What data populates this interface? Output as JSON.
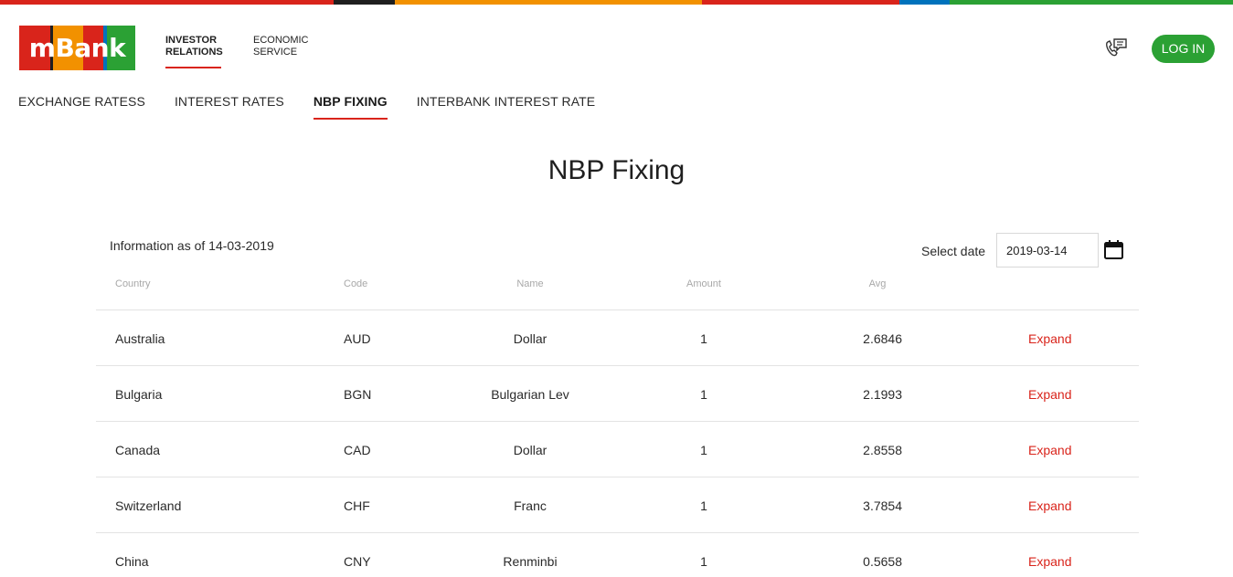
{
  "brand": {
    "logo_text": "mBank",
    "stripe_colors": [
      "#d9241b",
      "#1f1f1f",
      "#f29100",
      "#d9241b",
      "#0072bc",
      "#2ba134"
    ],
    "accent": "#d9241b",
    "login_color": "#2ba134"
  },
  "topnav": {
    "investor_relations": "INVESTOR RELATIONS",
    "economic_service": "ECONOMIC SERVICE"
  },
  "header": {
    "contact_icon": "phone-chat-icon",
    "login_label": "LOG IN"
  },
  "subnav": {
    "tabs": [
      {
        "label": "EXCHANGE RATESS"
      },
      {
        "label": "INTEREST RATES"
      },
      {
        "label": "NBP FIXING",
        "active": true
      },
      {
        "label": "INTERBANK INTEREST RATE"
      }
    ]
  },
  "page": {
    "title": "NBP Fixing",
    "info": "Information as of 14-03-2019",
    "select_date_label": "Select date",
    "date_value": "2019-03-14",
    "calendar_icon": "calendar-icon"
  },
  "table": {
    "headers": {
      "country": "Country",
      "code": "Code",
      "name": "Name",
      "amount": "Amount",
      "avg": "Avg"
    },
    "rows": [
      {
        "country": "Australia",
        "code": "AUD",
        "name": "Dollar",
        "amount": "1",
        "avg": "2.6846",
        "action": "Expand"
      },
      {
        "country": "Bulgaria",
        "code": "BGN",
        "name": "Bulgarian Lev",
        "amount": "1",
        "avg": "2.1993",
        "action": "Expand"
      },
      {
        "country": "Canada",
        "code": "CAD",
        "name": "Dollar",
        "amount": "1",
        "avg": "2.8558",
        "action": "Expand"
      },
      {
        "country": "Switzerland",
        "code": "CHF",
        "name": "Franc",
        "amount": "1",
        "avg": "3.7854",
        "action": "Expand"
      },
      {
        "country": "China",
        "code": "CNY",
        "name": "Renminbi",
        "amount": "1",
        "avg": "0.5658",
        "action": "Expand"
      }
    ]
  }
}
